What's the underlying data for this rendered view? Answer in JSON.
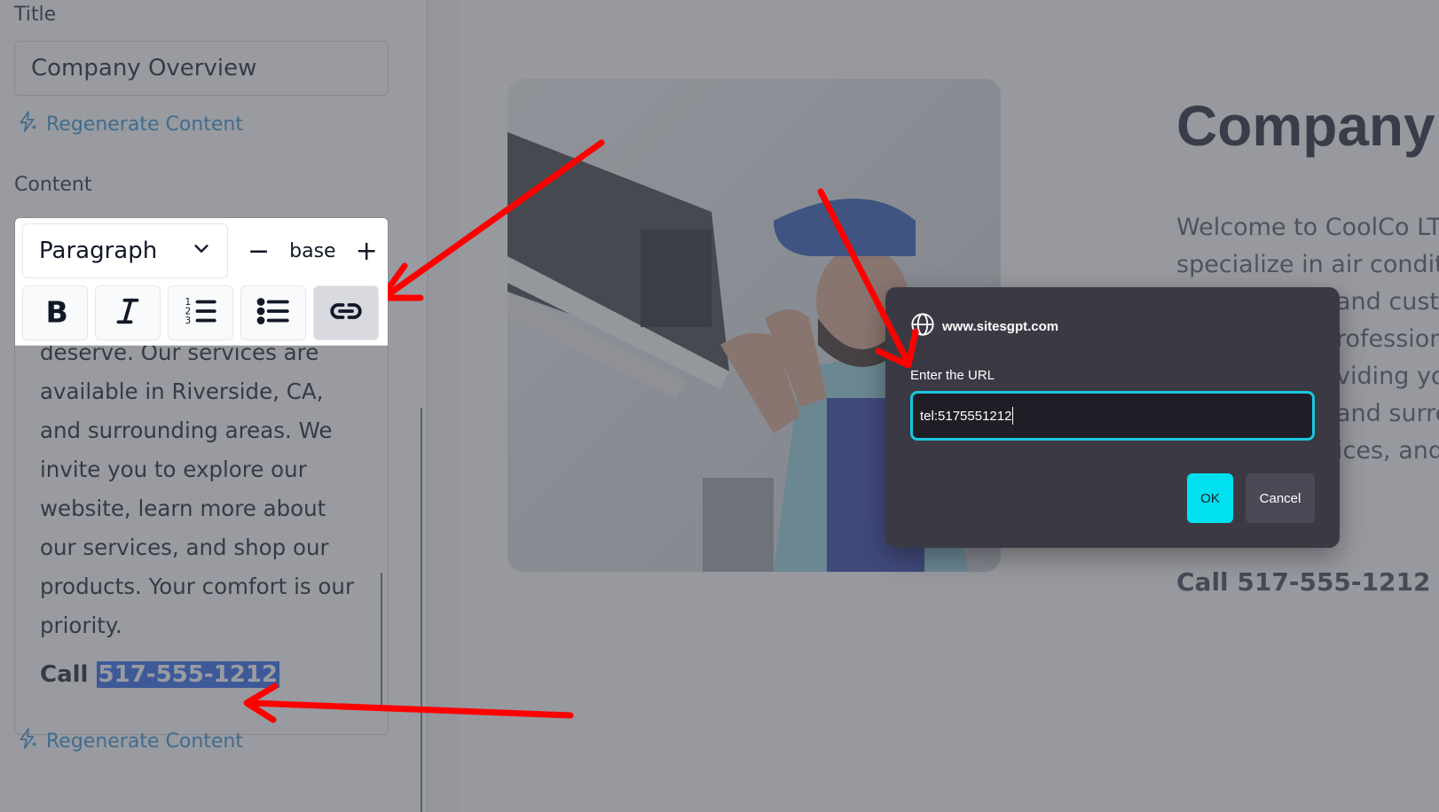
{
  "sidebar": {
    "title_label": "Title",
    "title_value": "Company Overview",
    "regenerate_label": "Regenerate Content",
    "content_label": "Content",
    "toolbar": {
      "block_type": "Paragraph",
      "size_minus": "−",
      "size_value": "base",
      "size_plus": "+"
    },
    "editor_text": "you with the comfort you deserve. Our services are available in Riverside, CA, and surrounding areas. We invite you to explore our website, learn more about our services, and shop our products. Your comfort is our priority.",
    "call_prefix": "Call ",
    "call_number": "517-555-1212"
  },
  "preview": {
    "heading": "Company O",
    "paragraph_lines": [
      "Welcome to CoolCo LTD",
      "specialize in air conditio",
      "and custo",
      "rofessiona",
      "viding you",
      "and surrou",
      "ices, and"
    ],
    "call_text": "Call 517-555-1212"
  },
  "dialog": {
    "origin": "www.sitesgpt.com",
    "prompt": "Enter the URL",
    "input_value": "tel:5175551212",
    "ok_label": "OK",
    "cancel_label": "Cancel"
  },
  "colors": {
    "accent_cyan": "#00e0ef",
    "link_blue": "#2f8fd6",
    "selection_blue": "#2563eb",
    "annotation_red": "#ff0000",
    "dialog_bg": "#3b3a44"
  }
}
